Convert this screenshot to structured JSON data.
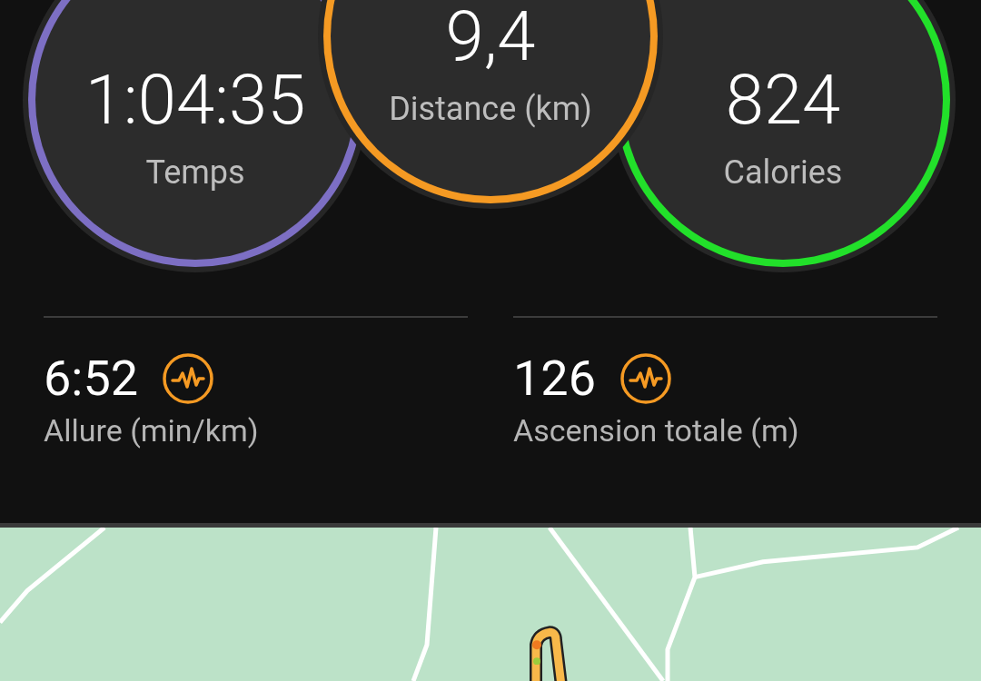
{
  "summary_circles": [
    {
      "value": "1:04:35",
      "label": "Temps",
      "color": "#7d6fc4"
    },
    {
      "value": "9,4",
      "label": "Distance (km)",
      "color": "#f59a23"
    },
    {
      "value": "824",
      "label": "Calories",
      "color": "#22e02a"
    }
  ],
  "stats": [
    {
      "value": "6:52",
      "label": "Allure (min/km)"
    },
    {
      "value": "126",
      "label": "Ascension totale (m)"
    }
  ]
}
